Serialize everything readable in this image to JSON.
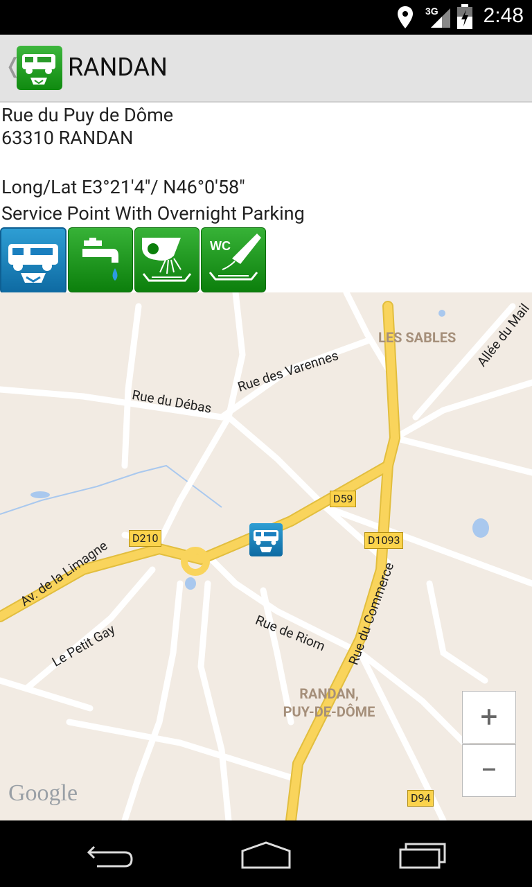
{
  "status": {
    "network": "3G",
    "time": "2:48"
  },
  "header": {
    "title": "RANDAN",
    "back_glyph": "❬"
  },
  "details": {
    "street": "Rue du Puy de Dôme",
    "city": "63310 RANDAN",
    "coords": "Long/Lat E3°21'4\"/ N46°0'58\"",
    "service": "Service Point With Overnight Parking",
    "badges": [
      "motorhome-service-icon",
      "water-tap-icon",
      "drain-grey-water-icon",
      "wc-dump-icon"
    ],
    "wc_text": "WC"
  },
  "map": {
    "streets": {
      "varennes": "Rue des Varennes",
      "debas": "Rue du Débas",
      "mail": "Allée du Mail",
      "limagne": "Av. de la Limagne",
      "petit_gay": "Le Petit Gay",
      "riom": "Rue de Riom",
      "commerce": "Rue du Commerce"
    },
    "places": {
      "sables": "LES SABLES",
      "randan_1": "RANDAN,",
      "randan_2": "PUY-DE-DÔME"
    },
    "signs": {
      "d59": "D59",
      "d210": "D210",
      "d1093": "D1093",
      "d94": "D94"
    },
    "zoom_in": "+",
    "zoom_out": "−",
    "logo": "Google"
  },
  "colors": {
    "accent_green": "#1a9a1a",
    "accent_blue": "#1a7fbf",
    "road_yellow": "#f9d45c",
    "map_bg": "#f2ebe3"
  }
}
